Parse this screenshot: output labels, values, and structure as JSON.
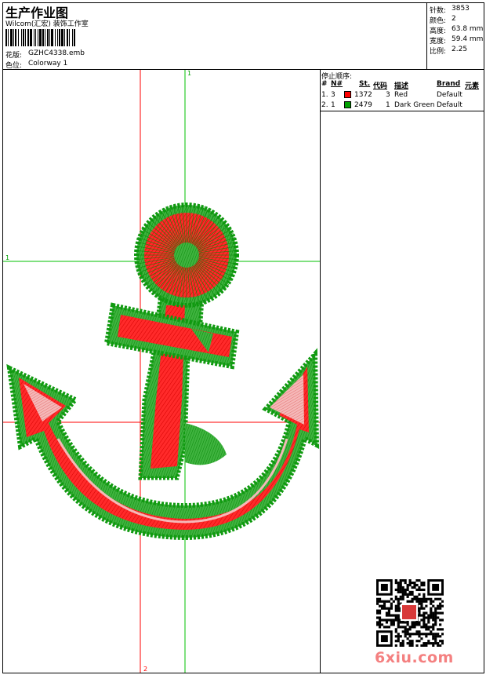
{
  "header": {
    "title": "生产作业图",
    "company": "Wilcom(汇宏) 装饰工作室",
    "design_label": "花版:",
    "design_value": "GZHC4338.emb",
    "colorway_label": "色位:",
    "colorway_value": "Colorway 1"
  },
  "stats": [
    {
      "label": "针数:",
      "value": "3853"
    },
    {
      "label": "颜色:",
      "value": "2"
    },
    {
      "label": "高度:",
      "value": "63.8 mm"
    },
    {
      "label": "宽度:",
      "value": "59.4 mm"
    },
    {
      "label": "比例:",
      "value": "2.25"
    }
  ],
  "stop_sequence": {
    "title": "停止顺序:",
    "headers": [
      "#",
      "N#",
      "St.",
      "代码",
      "描述",
      "Brand",
      "元素"
    ],
    "rows": [
      {
        "idx": "1.",
        "n": "3",
        "color": "#ff0000",
        "stitches": "1372",
        "code": "3",
        "desc": "Red",
        "brand": "Default"
      },
      {
        "idx": "2.",
        "n": "1",
        "color": "#00a000",
        "stitches": "2479",
        "code": "1",
        "desc": "Dark Green",
        "brand": "Default"
      }
    ]
  },
  "guides": {
    "label_h": "1",
    "label_top": "1",
    "label_bottom": "2"
  },
  "watermark": {
    "text": "6xiu.com"
  }
}
